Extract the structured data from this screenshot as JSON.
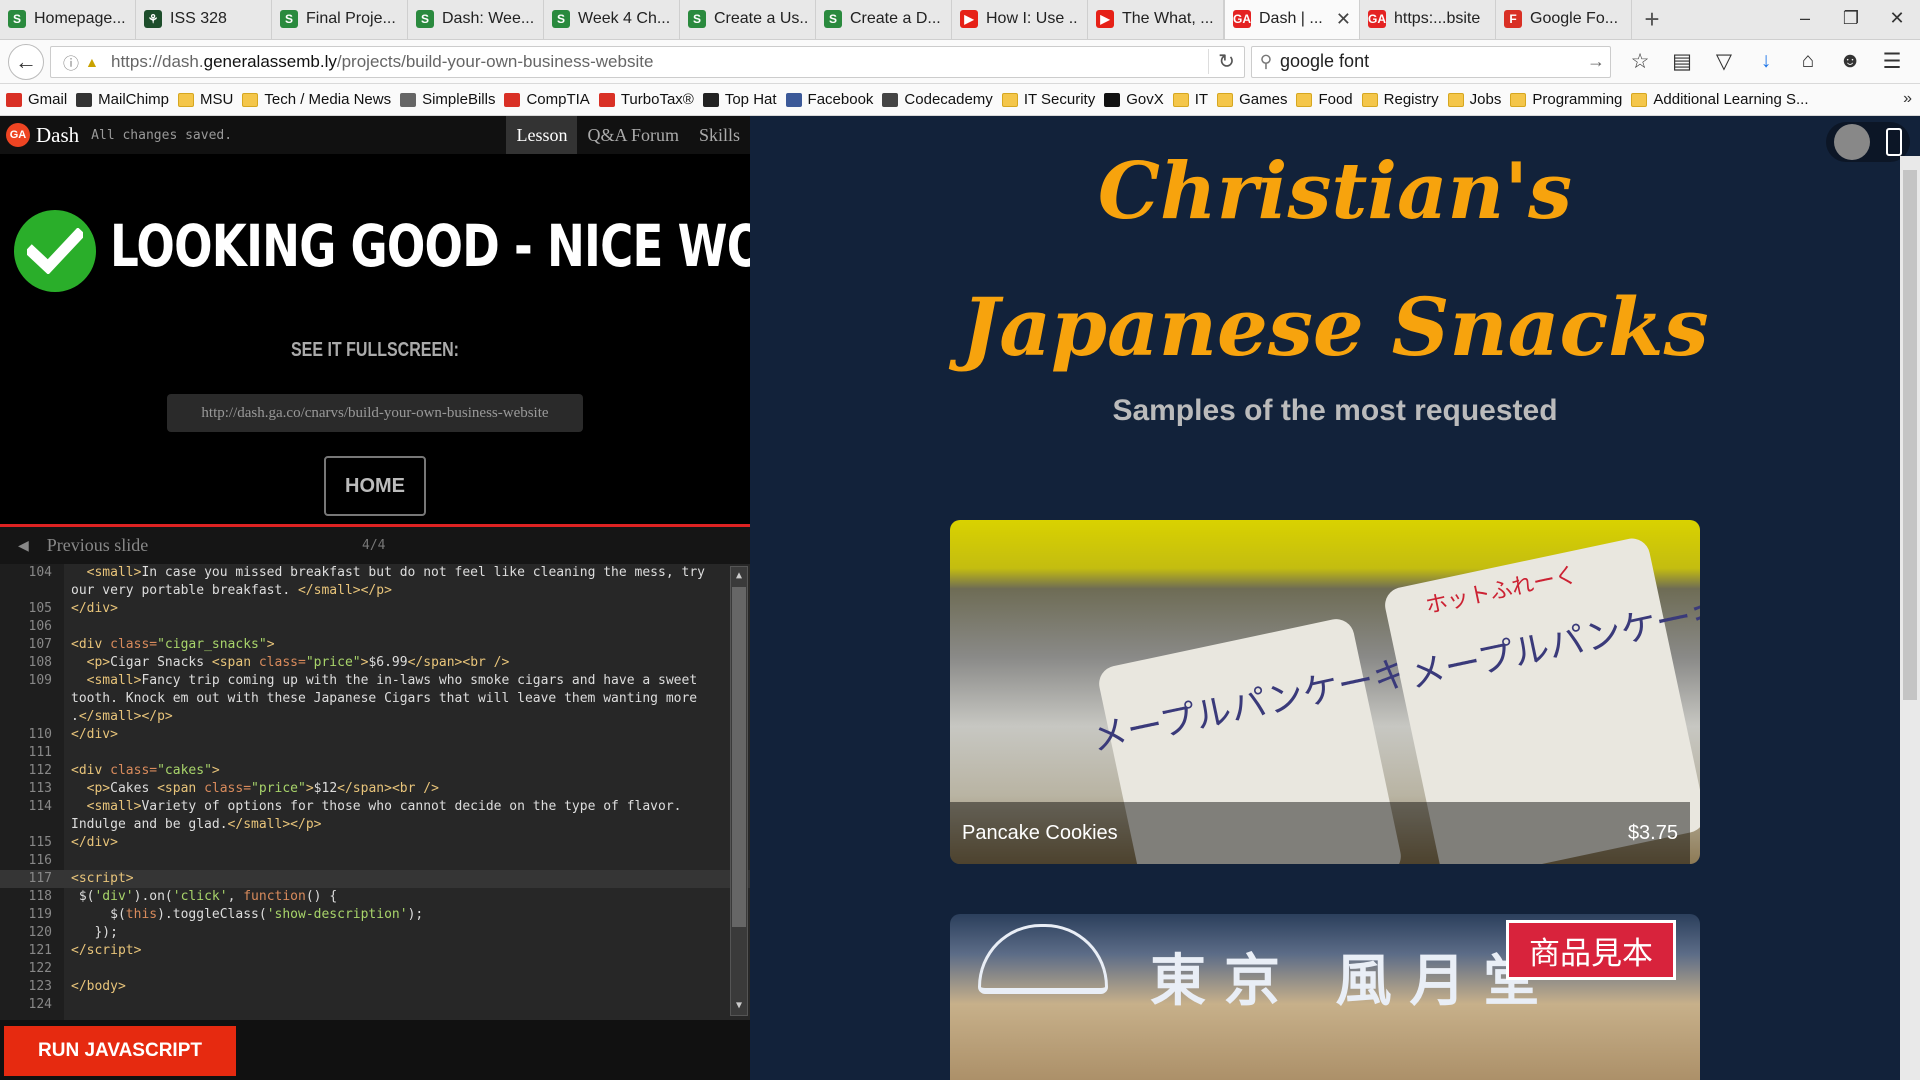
{
  "browser": {
    "tabs": [
      {
        "label": "Homepage...",
        "fav": "S",
        "color": "#2a8a3e"
      },
      {
        "label": "ISS 328",
        "fav": "⚘",
        "color": "#1d4d2b"
      },
      {
        "label": "Final Proje...",
        "fav": "S",
        "color": "#2a8a3e"
      },
      {
        "label": "Dash: Wee...",
        "fav": "S",
        "color": "#2a8a3e"
      },
      {
        "label": "Week 4 Ch...",
        "fav": "S",
        "color": "#2a8a3e"
      },
      {
        "label": "Create a Us...",
        "fav": "S",
        "color": "#2a8a3e"
      },
      {
        "label": "Create a D...",
        "fav": "S",
        "color": "#2a8a3e"
      },
      {
        "label": "How I: Use ...",
        "fav": "▶",
        "color": "#e62117"
      },
      {
        "label": "The What, ...",
        "fav": "▶",
        "color": "#e62117"
      },
      {
        "label": "Dash | ...",
        "fav": "GA",
        "color": "#e42222",
        "active": true
      },
      {
        "label": "https:...bsite",
        "fav": "GA",
        "color": "#e42222"
      },
      {
        "label": "Google Fo...",
        "fav": "F",
        "color": "#d93025"
      }
    ],
    "url_prefix": "https://dash.",
    "url_domain": "generalassemb.ly",
    "url_path": "/projects/build-your-own-business-website",
    "search_value": "google font",
    "bookmarks": [
      {
        "label": "Gmail",
        "icon": "gmail-icon",
        "color": "#d93025"
      },
      {
        "label": "MailChimp",
        "icon": "mailchimp-icon",
        "color": "#333"
      },
      {
        "label": "MSU",
        "icon": "folder-icon"
      },
      {
        "label": "Tech / Media News",
        "icon": "folder-icon"
      },
      {
        "label": "SimpleBills",
        "icon": "simplebills-icon",
        "color": "#666"
      },
      {
        "label": "CompTIA",
        "icon": "comptia-icon",
        "color": "#d93025"
      },
      {
        "label": "TurboTax®",
        "icon": "turbotax-icon",
        "color": "#d93025"
      },
      {
        "label": "Top Hat",
        "icon": "tophat-icon",
        "color": "#222"
      },
      {
        "label": "Facebook",
        "icon": "facebook-icon",
        "color": "#3b5998"
      },
      {
        "label": "Codecademy",
        "icon": "codecademy-icon",
        "color": "#444"
      },
      {
        "label": "IT Security",
        "icon": "folder-icon"
      },
      {
        "label": "GovX",
        "icon": "govx-icon",
        "color": "#111"
      },
      {
        "label": "IT",
        "icon": "folder-icon"
      },
      {
        "label": "Games",
        "icon": "folder-icon"
      },
      {
        "label": "Food",
        "icon": "folder-icon"
      },
      {
        "label": "Registry",
        "icon": "folder-icon"
      },
      {
        "label": "Jobs",
        "icon": "folder-icon"
      },
      {
        "label": "Programming",
        "icon": "folder-icon"
      },
      {
        "label": "Additional Learning S...",
        "icon": "folder-icon"
      }
    ]
  },
  "dash": {
    "app_name": "Dash",
    "logo_text": "GA",
    "saved_status": "All changes saved.",
    "tabs": [
      "Lesson",
      "Q&A Forum",
      "Skills"
    ],
    "headline": "LOOKING GOOD - NICE WORK!",
    "see_fullscreen": "SEE IT FULLSCREEN:",
    "fullscreen_url": "http://dash.ga.co/cnarvs/build-your-own-business-website",
    "home_button": "HOME",
    "previous_slide": "Previous slide",
    "slide_count": "4/4",
    "run_button": "RUN JAVASCRIPT",
    "accent_color": "#e62a10",
    "success_color": "#2aae2a"
  },
  "code_lines": [
    {
      "n": "104",
      "html": "  <span class='t'>&lt;small&gt;</span>In case you missed breakfast but do not feel like cleaning the mess, try"
    },
    {
      "n": "",
      "html": "our very portable breakfast. <span class='t'>&lt;/small&gt;&lt;/p&gt;</span>"
    },
    {
      "n": "105",
      "html": "<span class='t'>&lt;/div&gt;</span>"
    },
    {
      "n": "106",
      "html": ""
    },
    {
      "n": "107",
      "html": "<span class='t'>&lt;div</span> <span class='k'>class=</span><span class='s'>\"cigar_snacks\"</span><span class='t'>&gt;</span>"
    },
    {
      "n": "108",
      "html": "  <span class='t'>&lt;p&gt;</span>Cigar Snacks <span class='t'>&lt;span</span> <span class='k'>class=</span><span class='s'>\"price\"</span><span class='t'>&gt;</span>$6.99<span class='t'>&lt;/span&gt;&lt;br /&gt;</span>"
    },
    {
      "n": "109",
      "html": "  <span class='t'>&lt;small&gt;</span>Fancy trip coming up with the in-laws who smoke cigars and have a sweet"
    },
    {
      "n": "",
      "html": "tooth. Knock em out with these Japanese Cigars that will leave them wanting more"
    },
    {
      "n": "",
      "html": ".<span class='t'>&lt;/small&gt;&lt;/p&gt;</span>"
    },
    {
      "n": "110",
      "html": "<span class='t'>&lt;/div&gt;</span>"
    },
    {
      "n": "111",
      "html": ""
    },
    {
      "n": "112",
      "html": "<span class='t'>&lt;div</span> <span class='k'>class=</span><span class='s'>\"cakes\"</span><span class='t'>&gt;</span>"
    },
    {
      "n": "113",
      "html": "  <span class='t'>&lt;p&gt;</span>Cakes <span class='t'>&lt;span</span> <span class='k'>class=</span><span class='s'>\"price\"</span><span class='t'>&gt;</span>$12<span class='t'>&lt;/span&gt;&lt;br /&gt;</span>"
    },
    {
      "n": "114",
      "html": "  <span class='t'>&lt;small&gt;</span>Variety of options for those who cannot decide on the type of flavor."
    },
    {
      "n": "",
      "html": "Indulge and be glad.<span class='t'>&lt;/small&gt;&lt;/p&gt;</span>"
    },
    {
      "n": "115",
      "html": "<span class='t'>&lt;/div&gt;</span>"
    },
    {
      "n": "116",
      "html": ""
    },
    {
      "n": "117",
      "html": "<span class='t'>&lt;script&gt;</span>",
      "cur": true
    },
    {
      "n": "118",
      "html": " $(<span class='s'>'div'</span>).on(<span class='s'>'click'</span>, <span class='k'>function</span>() {"
    },
    {
      "n": "119",
      "html": "     $(<span class='k'>this</span>).toggleClass(<span class='s'>'show-description'</span>);"
    },
    {
      "n": "120",
      "html": "   });"
    },
    {
      "n": "121",
      "html": "<span class='t'>&lt;/script&gt;</span>"
    },
    {
      "n": "122",
      "html": ""
    },
    {
      "n": "123",
      "html": "<span class='t'>&lt;/body&gt;</span>"
    },
    {
      "n": "124",
      "html": ""
    }
  ],
  "preview": {
    "title_line1": "Christian's",
    "title_line2": "Japanese Snacks",
    "subtitle": "Samples of the most requested",
    "products": [
      {
        "name": "Pancake Cookies",
        "price": "$3.75"
      }
    ],
    "package_text_1": "メープルパンケーキ",
    "package_text_2": "ホットふれーく",
    "brand_text": "東京 風月堂",
    "stamp_text": "商品見本",
    "title_color": "#f7a30d",
    "background_color": "#12223a"
  }
}
